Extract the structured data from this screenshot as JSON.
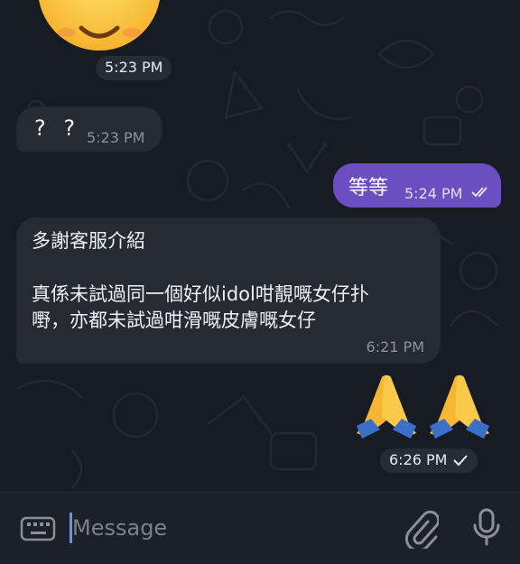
{
  "sticker": {
    "emoji": "smiling-face",
    "time": "5:23 PM"
  },
  "messages": [
    {
      "id": "qq",
      "text": "? ?",
      "time": "5:23 PM",
      "direction": "incoming"
    },
    {
      "id": "out",
      "text": "等等",
      "time": "5:24 PM",
      "direction": "outgoing",
      "status": "read"
    },
    {
      "id": "long",
      "line1": "多謝客服介紹",
      "line2": "真係未試過同一個好似idol咁靚嘅女仔扑",
      "line3": "嘢，亦都未試過咁滑嘅皮膚嘅女仔",
      "time": "6:21 PM",
      "direction": "incoming"
    },
    {
      "id": "pray",
      "emoji": "folded-hands x2",
      "time": "6:26 PM",
      "direction": "outgoing",
      "status": "sent"
    }
  ],
  "input": {
    "placeholder": "Message",
    "value": ""
  },
  "colors": {
    "background": "#171c24",
    "incoming_bubble": "#262b33",
    "outgoing_bubble": "#6b4fc2",
    "accent": "#6e8ff1"
  },
  "icons": {
    "keyboard": "keyboard-icon",
    "attach": "paperclip-icon",
    "mic": "microphone-icon"
  }
}
